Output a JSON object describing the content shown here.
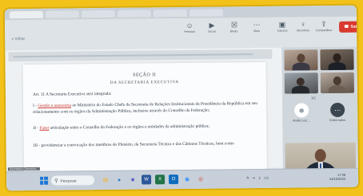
{
  "meeting": {
    "shared_label": "« Voltar",
    "share_tools": [
      {
        "label": "Pessoas",
        "icon": "people-icon",
        "glyph": "☺"
      },
      {
        "label": "Iniciar",
        "icon": "play-icon",
        "glyph": "▶"
      },
      {
        "label": "Bloqu.",
        "icon": "lock-icon",
        "glyph": "☒"
      },
      {
        "label": "Mais",
        "icon": "more-icon",
        "glyph": "⋯"
      }
    ],
    "meeting_tools": [
      {
        "label": "Câmera",
        "icon": "camera-icon",
        "glyph": "▣"
      },
      {
        "label": "Microfone",
        "icon": "microphone-icon",
        "glyph": "♀"
      },
      {
        "label": "Compartilhar",
        "icon": "share-icon",
        "glyph": "⇪"
      }
    ],
    "leave_label": "Sair",
    "leave_icon": "phone-icon"
  },
  "document": {
    "heading": "SEÇÃO II",
    "subheading": "DA SECRETARIA EXECUTIVA",
    "paragraphs": [
      "Art. 11 A Secretaria Executiva será integrada:",
      "I - Gestão e assessoria ao Ministério do Estado Chefe da Secretaria de Relações Institucionais da Presidência da República em seu relacionamento com os órgãos da Administração Pública, inclusive através do Conselho da Federação;",
      "II - Fazer articulação entre o Conselho da Federação e os órgãos e entidades da administração pública;",
      "III - providenciar a convocação dos membros do Plenário, da Secretaria Técnica e das Câmaras Técnicas, bem como"
    ],
    "underlined_red": [
      "Gestão e assessoria",
      "Fazer"
    ]
  },
  "gallery": {
    "page_indicator": "1/2",
    "avatars": [
      {
        "caption": "André Luiz ...",
        "icon": "user-avatar-icon",
        "glyph": "☻"
      },
      {
        "caption": "Exibir todos",
        "icon": "more-icon",
        "glyph": "⋯"
      }
    ]
  },
  "taskbar": {
    "name_strip": "Secretaria Executiva...",
    "search_placeholder": "Pesquisar",
    "search_icon": "search-icon",
    "apps": [
      {
        "icon": "file-explorer-icon",
        "glyph": "▤",
        "color": "#f2b233"
      },
      {
        "icon": "browser-icon",
        "glyph": "●",
        "color": "#2d7fd2"
      },
      {
        "icon": "teams-icon",
        "glyph": "■",
        "color": "#5b5fc7"
      },
      {
        "icon": "word-icon",
        "glyph": "W",
        "color": "#2b579a"
      },
      {
        "icon": "excel-icon",
        "glyph": "X",
        "color": "#217346"
      },
      {
        "icon": "outlook-icon",
        "glyph": "O",
        "color": "#0f6cbd"
      },
      {
        "icon": "zoom-icon",
        "glyph": "◉",
        "color": "#2d8cff"
      },
      {
        "icon": "chrome-icon",
        "glyph": "◎",
        "color": "#db4437"
      }
    ],
    "tray_icons": [
      {
        "icon": "chevron-up-icon",
        "glyph": "˄"
      },
      {
        "icon": "wifi-icon",
        "glyph": "⌁"
      },
      {
        "icon": "volume-icon",
        "glyph": "♪"
      },
      {
        "icon": "battery-icon",
        "glyph": "▭"
      }
    ],
    "time": "17:08",
    "date": "04/10/2023"
  },
  "colors": {
    "background": "#f3c21a",
    "leave_button": "#d93a2f",
    "red_underline": "#c8362e"
  }
}
